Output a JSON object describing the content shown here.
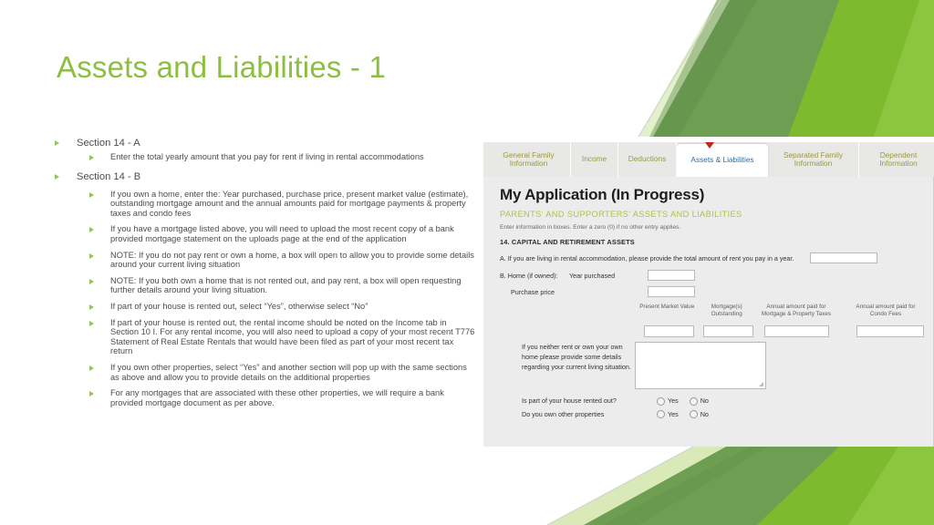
{
  "slide": {
    "title": "Assets and Liabilities - 1",
    "bullets": [
      {
        "level": 1,
        "text": "Section 14 - A"
      },
      {
        "level": 2,
        "text": "Enter the total yearly amount that you pay for rent if living in rental accommodations"
      },
      {
        "level": 1,
        "text": "Section 14 - B"
      },
      {
        "level": 2,
        "text": "If you own a home, enter the: Year purchased, purchase price, present market value (estimate), outstanding mortgage amount and the annual amounts paid for mortgage payments & property taxes and condo fees"
      },
      {
        "level": 2,
        "text": "If you have a mortgage listed above, you will need to upload the most recent copy of a bank provided mortgage statement on the uploads page at the end of the application"
      },
      {
        "level": 2,
        "text": "NOTE: If you do not pay rent or own a home, a box will open to allow you to provide some details around your current living situation"
      },
      {
        "level": 2,
        "text": "NOTE: If you both own a home that is not rented out, and pay rent, a box will open requesting further details around your living situation."
      },
      {
        "level": 2,
        "text": "If part of your house is rented out, select “Yes”, otherwise select “No”"
      },
      {
        "level": 2,
        "text": "If part of your house is rented out, the rental income should be noted on the Income tab in Section 10 I. For any rental income, you will also need to upload a copy of your most recent T776 Statement of Real Estate Rentals that would have been filed as part of your most recent tax return"
      },
      {
        "level": 2,
        "text": "If you own other properties, select “Yes” and another section will pop up with the same sections as above and allow you to provide details on the additional properties"
      },
      {
        "level": 2,
        "text": "For any mortgages that are associated with these other properties, we will require a bank provided mortgage document as per above."
      }
    ],
    "colors": {
      "title_green": "#8cbf3f",
      "bullet_green": "#94c356",
      "bg_dark_green": "#6d9e52",
      "bg_mid_green": "#7dba2d",
      "bg_light_green": "#8cc63f",
      "bg_pale_green": "#d9eab8"
    }
  },
  "screenshot": {
    "tabs": [
      {
        "label": "General Family Information",
        "active": false
      },
      {
        "label": "Income",
        "active": false
      },
      {
        "label": "Deductions",
        "active": false
      },
      {
        "label": "Assets & Liabilities",
        "active": true
      },
      {
        "label": "Separated Family Information",
        "active": false
      },
      {
        "label": "Dependent Information",
        "active": false
      }
    ],
    "marker_icon": "red-down-arrow-icon",
    "app_title": "My Application (In Progress)",
    "section_title": "PARENTS' AND SUPPORTERS' ASSETS AND LIABILITIES",
    "hint": "Enter information in boxes.  Enter a zero (0) if no other entry applies.",
    "capital_heading": "14. CAPITAL AND RETIREMENT ASSETS",
    "question_a": "A. If you are living in rental accommodation, please provide the total amount of rent you pay in a year.",
    "rent_value": "",
    "label_home": "B. Home (if owned):",
    "label_year_purchased": "Year purchased",
    "year_value": "",
    "label_purchase_price": "Purchase price",
    "price_value": "",
    "column_headers": [
      "Present Market Value",
      "Mortgage(s) Outstanding",
      "Annual amount paid for Mortgage & Property Taxes",
      "Annual amount paid for Condo Fees"
    ],
    "column_values": [
      "",
      "",
      "",
      ""
    ],
    "neither_label": "If you neither rent or own your own home please provide some details regarding your current living situation.",
    "neither_value": "",
    "questions": [
      {
        "label": "Is part of your house rented out?",
        "options": [
          "Yes",
          "No"
        ],
        "selected": ""
      },
      {
        "label": "Do you own other properties",
        "options": [
          "Yes",
          "No"
        ],
        "selected": ""
      }
    ],
    "colors": {
      "tab_strip": "#e8e8e6",
      "tab_text": "#9a9a3c",
      "active_tab_text": "#2f6ca4",
      "panel_bg": "#ececec",
      "section_green": "#adc441",
      "marker_red": "#c0271c"
    }
  }
}
